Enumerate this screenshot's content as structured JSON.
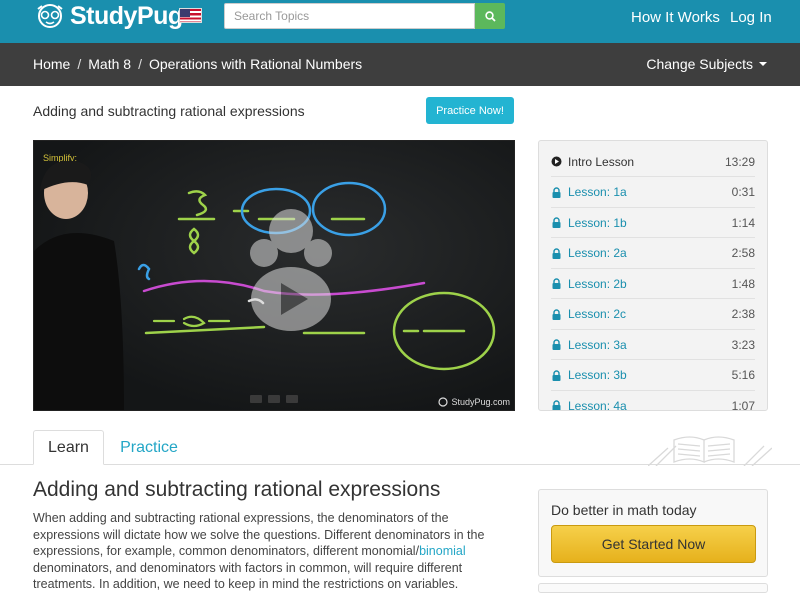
{
  "header": {
    "brand": "StudyPug",
    "search_placeholder": "Search Topics",
    "nav": [
      "How It Works",
      "Log In"
    ]
  },
  "breadcrumb": {
    "items": [
      "Home",
      "Math 8",
      "Operations with Rational Numbers"
    ],
    "change_subjects": "Change Subjects"
  },
  "lesson": {
    "title": "Adding and subtracting rational expressions",
    "practice_button": "Practice Now!"
  },
  "video": {
    "prompt_label": "Simplify:",
    "watermark": "StudyPug.com",
    "icons": [
      "play-icon"
    ]
  },
  "lesson_list": [
    {
      "name": "Intro Lesson",
      "time": "13:29",
      "icon": "play-circle-icon"
    },
    {
      "name": "Lesson: 1a",
      "time": "0:31",
      "icon": "lock-icon"
    },
    {
      "name": "Lesson: 1b",
      "time": "1:14",
      "icon": "lock-icon"
    },
    {
      "name": "Lesson: 2a",
      "time": "2:58",
      "icon": "lock-icon"
    },
    {
      "name": "Lesson: 2b",
      "time": "1:48",
      "icon": "lock-icon"
    },
    {
      "name": "Lesson: 2c",
      "time": "2:38",
      "icon": "lock-icon"
    },
    {
      "name": "Lesson: 3a",
      "time": "3:23",
      "icon": "lock-icon"
    },
    {
      "name": "Lesson: 3b",
      "time": "5:16",
      "icon": "lock-icon"
    },
    {
      "name": "Lesson: 4a",
      "time": "1:07",
      "icon": "lock-icon"
    }
  ],
  "tabs": [
    "Learn",
    "Practice"
  ],
  "article": {
    "title": "Adding and subtracting rational expressions",
    "body_before_link": "When adding and subtracting rational expressions, the denominators of the expressions will dictate how we solve the questions. Different denominators in the expressions, for example, common denominators, different monomial/",
    "link_text": "binomial",
    "body_after_link": " denominators, and denominators with factors in common, will require different treatments. In addition, we need to keep in mind the restrictions on variables."
  },
  "promo": {
    "title": "Do better in math today",
    "button": "Get Started Now"
  },
  "colors": {
    "header": "#1a8fae",
    "breadcrumb_bar": "#3e3e3e",
    "accent": "#23b4d2",
    "link": "#1a8fae",
    "cta": "#e6b11c"
  }
}
